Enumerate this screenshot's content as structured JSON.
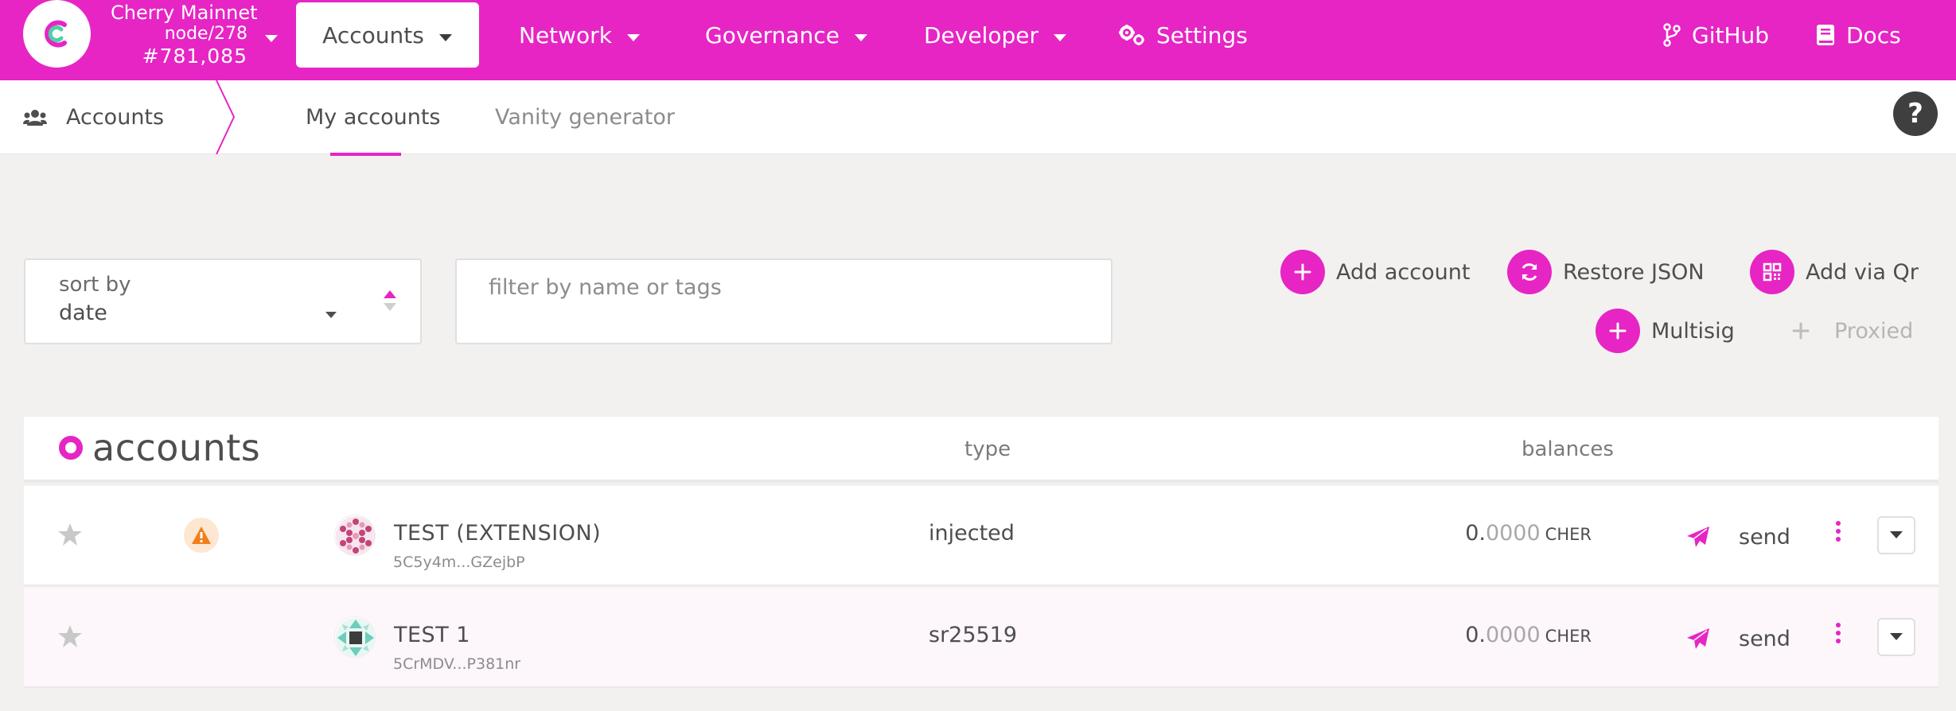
{
  "colors": {
    "brand": "#e625c4",
    "text": "#4e4e4e",
    "muted": "#8c8c8c",
    "background": "#f2f1f0"
  },
  "chain": {
    "name": "Cherry Mainnet",
    "node": "node/278",
    "block": "#781,085",
    "logo_icon": "cherry-logo-icon"
  },
  "nav": {
    "accounts": "Accounts",
    "network": "Network",
    "governance": "Governance",
    "developer": "Developer",
    "settings": "Settings",
    "github": "GitHub",
    "docs": "Docs"
  },
  "subnav": {
    "section": "Accounts",
    "tabs": [
      {
        "label": "My accounts",
        "active": true
      },
      {
        "label": "Vanity generator",
        "active": false
      }
    ],
    "help": "?"
  },
  "controls": {
    "sort_label": "sort by",
    "sort_value": "date",
    "filter_placeholder": "filter by name or tags",
    "actions": {
      "add_account": "Add account",
      "restore_json": "Restore JSON",
      "add_via_qr": "Add via Qr",
      "multisig": "Multisig",
      "proxied": "Proxied"
    }
  },
  "table": {
    "title": "accounts",
    "col_type": "type",
    "col_balances": "balances",
    "rows": [
      {
        "name": "TEST (EXTENSION)",
        "address": "5C5y4m...GZejbP",
        "type": "injected",
        "balance_int": "0.",
        "balance_dec": "0000",
        "unit": "CHER",
        "send": "send",
        "warning": true
      },
      {
        "name": "TEST 1",
        "address": "5CrMDV...P381nr",
        "type": "sr25519",
        "balance_int": "0.",
        "balance_dec": "0000",
        "unit": "CHER",
        "send": "send",
        "warning": false
      }
    ]
  }
}
